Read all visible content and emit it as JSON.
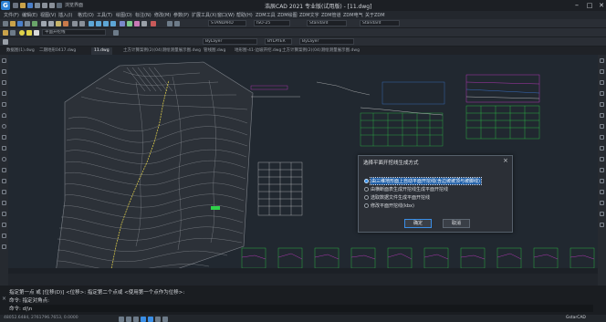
{
  "window": {
    "title": "浩辰CAD 2021 专业版(试用版) - [11.dwg]",
    "minimize": "–",
    "maximize": "□",
    "close": "✕"
  },
  "quickaccess": {
    "extra_label": "浏览界面"
  },
  "menu": {
    "items": [
      "文件(F)",
      "编辑(E)",
      "视图(V)",
      "插入(I)",
      "格式(O)",
      "工具(T)",
      "绘图(D)",
      "标注(N)",
      "修改(M)",
      "参数(P)",
      "扩展工具(X)",
      "窗口(W)",
      "帮助(H)",
      "ZDM工具",
      "ZDM绘图",
      "ZDM文字",
      "ZDM管道",
      "ZDM电气",
      "关于ZDM"
    ]
  },
  "toolbars": {
    "textstyle": "STANDARD",
    "dimstyle": "ISO-25",
    "tablestyle": "Standard",
    "mleaderstyle": "Standard",
    "current_layer": "平面开挖线",
    "layer_color": "ByLayer",
    "linetype": "BYLAYER",
    "lineweight": "ByLayer"
  },
  "tabs": [
    {
      "label": "数据图(1).dwg",
      "active": false
    },
    {
      "label": "二期地形0417.dwg",
      "active": false
    },
    {
      "label": "11.dwg",
      "active": true
    },
    {
      "label": "土方计算案例(2)(04)测绘测量展示图.dwg",
      "active": false
    },
    {
      "label": "管线图.dwg",
      "active": false
    },
    {
      "label": "地形图-41-边坡开挖.dwg",
      "active": false
    },
    {
      "label": "土方计算案例(2)(04)测绘测量展示图.dwg",
      "active": false
    }
  ],
  "dialog": {
    "title": "选择平面开挖线生成方式",
    "options": [
      {
        "label": "由三维地形面上自动平面开挖线(含边坡坡顶与坡脚线)",
        "selected": true
      },
      {
        "label": "由横断面表生成开挖线生成平面开挖线",
        "selected": false
      },
      {
        "label": "选取数据文件生成平面开挖线",
        "selected": false
      },
      {
        "label": "修改平面开挖线(kbx)",
        "selected": false
      }
    ],
    "ok": "确定",
    "cancel": "取消"
  },
  "command": {
    "line1": "指定第一点 或 [位移(D)] <位移>: 指定第二个点或 <使用第一个点作为位移>:",
    "line2": "命令: 指定对角点:",
    "prompt": "命令: d|\\n"
  },
  "status": {
    "coords": "48052.6484, 2761796.7653, 0.0000",
    "app_badge": "GstarCAD"
  },
  "colors": {
    "accent": "#3a8ee6",
    "canvas": "#212830",
    "contour": "#8c9097",
    "alignment": "#d8c84a",
    "section_green": "#2fd14a",
    "section_magenta": "#d23bd2",
    "section_blue": "#3d82e8"
  }
}
